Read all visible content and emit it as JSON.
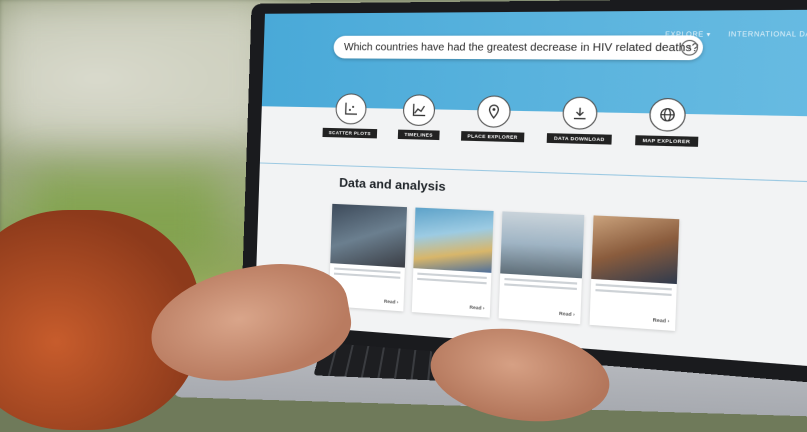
{
  "screen": {
    "search": {
      "query": "Which countries have had the greatest decrease in HIV related deaths?"
    },
    "nav": [
      "EXPLORE ▾",
      "INTERNATIONAL DATA COMPARE ▾"
    ],
    "tools": [
      {
        "label": "SCATTER PLOTS",
        "icon": "scatter-plot-icon"
      },
      {
        "label": "TIMELINES",
        "icon": "line-chart-icon"
      },
      {
        "label": "PLACE EXPLORER",
        "icon": "map-pin-icon"
      },
      {
        "label": "DATA DOWNLOAD",
        "icon": "download-icon"
      },
      {
        "label": "MAP EXPLORER",
        "icon": "globe-icon"
      }
    ],
    "section": {
      "title": "Data and analysis"
    },
    "cards": [
      {
        "tag": "",
        "link": "Read ›"
      },
      {
        "tag": "",
        "link": "Read ›"
      },
      {
        "tag": "",
        "link": "Read ›"
      },
      {
        "tag": "",
        "link": "Read ›"
      }
    ]
  },
  "colors": {
    "accent": "#49a9d8",
    "label_bg": "#222222"
  }
}
